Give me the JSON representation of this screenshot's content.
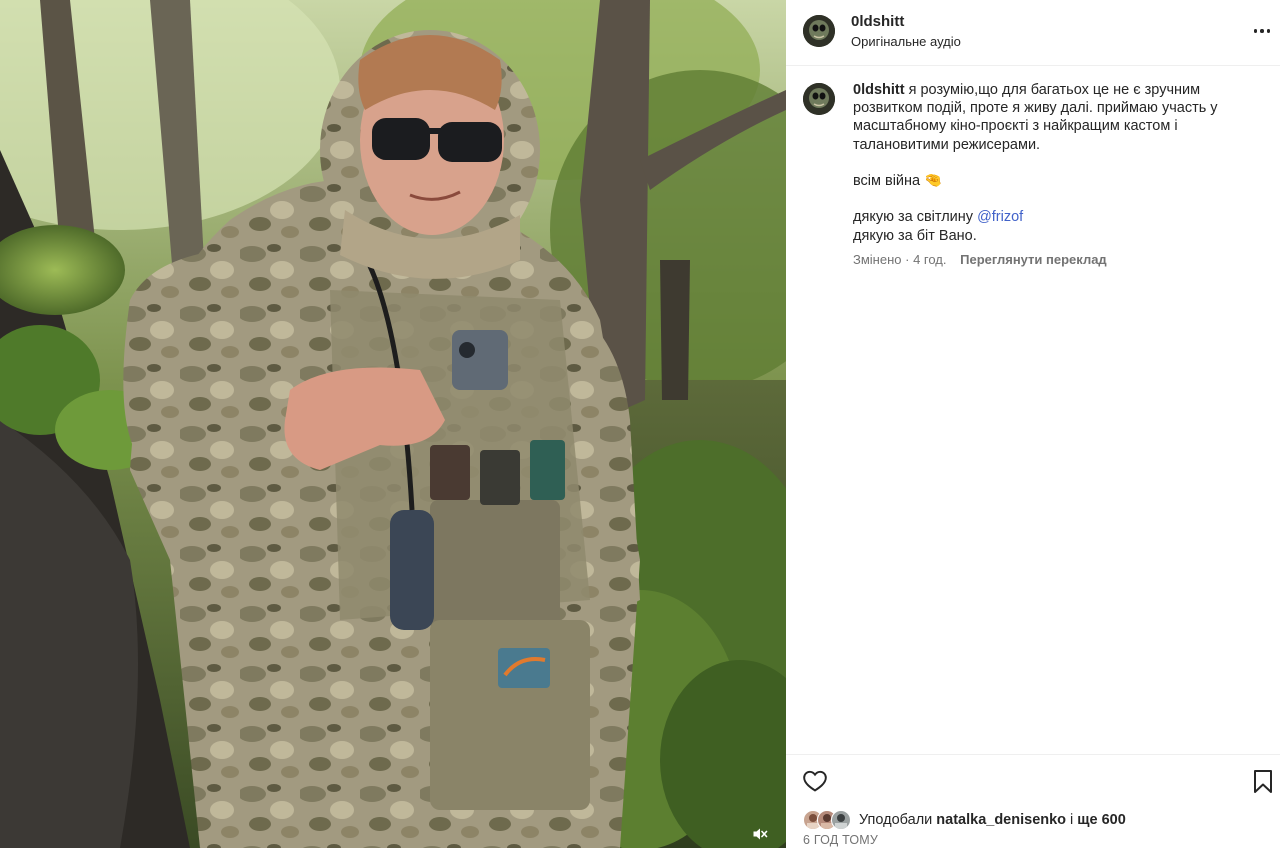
{
  "post": {
    "username": "0ldshitt",
    "audio_label": "Оригінальне аудіо",
    "media_description_icon": "video-photo"
  },
  "caption": {
    "username": "0ldshitt",
    "text_first": "я розумію,що для багатьох це не є зручним розвитком подій, проте я живу далі. приймаю участь у масштабному кіно-проєкті з найкращим кастом і талановитими режисерами.",
    "line_war": "всім війна 🤏",
    "line_photo_prefix": "дякую за світлину",
    "mention": "@frizof",
    "line_beat": "дякую за біт Вано.",
    "edited_label": "Змінено",
    "edited_time": "4 год.",
    "translate_label": "Переглянути переклад"
  },
  "footer": {
    "likes_prefix": "Уподобали",
    "liker": "natalka_denisenko",
    "likes_joiner": "і",
    "likes_rest": "ще 600",
    "post_time": "6 ГОД ТОМУ"
  },
  "colors": {
    "mention": "#4162c9",
    "meta_gray": "#737373",
    "text": "#262626"
  }
}
